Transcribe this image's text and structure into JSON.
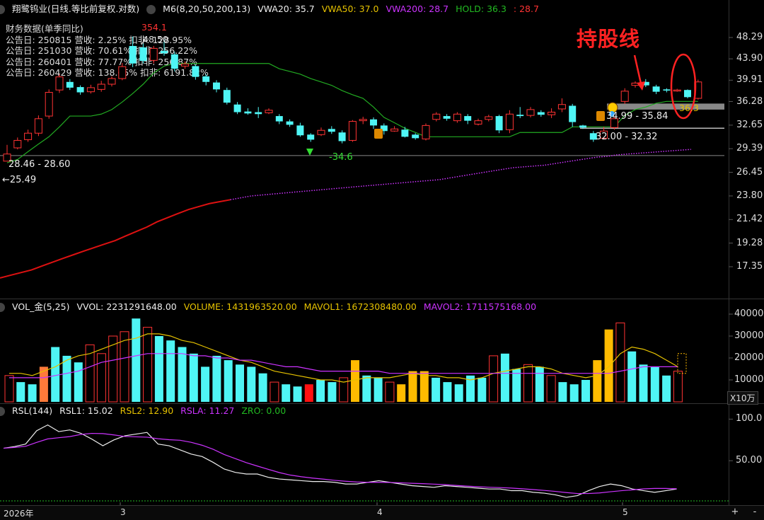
{
  "header": {
    "title": "翔鹭钨业(日线.等比前复权.对数)",
    "m6": "M6(8,20,50,200,13)",
    "vwa20": "VWA20: 35.7",
    "vwa50": "VWA50: 37.0",
    "vwa200": "VWA200: 28.7",
    "hold": "HOLD: 36.3",
    "hold_val2": ": 28.7"
  },
  "finance": {
    "title": "财务数据(单季同比)",
    "rows": [
      "公告日: 250815  营收: 2.25%  扣非: 128.95%",
      "公告日: 251030  营收: 70.61%  扣非: 256.22%",
      "公告日: 260401  营收: 77.77%  扣非: 256.87%",
      "公告日: 260429  营收: 138.65%  扣非: 6191.82%"
    ]
  },
  "annotations": {
    "peak": "354.1",
    "peak2": "48.50",
    "low_label": "28.46 - 28.60",
    "arrow_label": "←25.49",
    "diamond_label": "-34.6",
    "band1": "34.99 - 35.84",
    "band2": "32.00 - 32.32",
    "hold_tag": "36.3",
    "callout": "持股线"
  },
  "price_axis": [
    "48.29",
    "43.90",
    "39.91",
    "36.28",
    "32.65",
    "29.39",
    "26.45",
    "23.80",
    "21.42",
    "19.28",
    "17.35"
  ],
  "volume_header": {
    "name": "VOL_金(5,25)",
    "vvol": "VVOL: 2231291648.00",
    "volume": "VOLUME: 1431963520.00",
    "mavol1": "MAVOL1: 1672308480.00",
    "mavol2": "MAVOL2: 1711575168.00"
  },
  "volume_axis": [
    "40000",
    "30000",
    "20000",
    "10000"
  ],
  "volume_unit": "X10万",
  "rsl_header": {
    "name": "RSL(144)",
    "rsl1": "RSL1: 15.02",
    "rsl2": "RSL2: 12.90",
    "rsla": "RSLA: 11.27",
    "zro": "ZRO: 0.00"
  },
  "rsl_axis": [
    "100.0",
    "50.00"
  ],
  "time_axis": [
    "2026年",
    "3",
    "4",
    "5"
  ],
  "zoom": {
    "plus": "+",
    "minus": "-"
  },
  "colors": {
    "up": "#ff3333",
    "down": "#4ff5f5",
    "gold": "#ffbb00",
    "orange": "#ff7a3a",
    "green": "#22aa22",
    "purple": "#cc33ff",
    "yellow": "#e6c200"
  },
  "chart_data": {
    "type": "candlestick",
    "candles": [
      [
        27.8,
        28.7,
        28.2,
        29.9,
        "u"
      ],
      [
        29.5,
        30.5,
        29.3,
        30.9,
        "u"
      ],
      [
        30.6,
        31.5,
        30.3,
        32.0,
        "u"
      ],
      [
        31.5,
        33.6,
        31.1,
        34.1,
        "u"
      ],
      [
        34.0,
        37.8,
        33.6,
        38.3,
        "u"
      ],
      [
        38.2,
        40.5,
        37.7,
        41.0,
        "u"
      ],
      [
        39.6,
        38.6,
        38.2,
        40.1,
        "d"
      ],
      [
        38.7,
        37.8,
        37.4,
        39.0,
        "d"
      ],
      [
        37.9,
        38.6,
        37.6,
        39.1,
        "u"
      ],
      [
        38.3,
        39.2,
        37.9,
        39.8,
        "u"
      ],
      [
        39.2,
        40.2,
        38.8,
        40.6,
        "u"
      ],
      [
        40.2,
        42.4,
        39.9,
        43.1,
        "u"
      ],
      [
        43.0,
        46.5,
        42.3,
        48.5,
        "d"
      ],
      [
        46.2,
        43.5,
        43.0,
        47.0,
        "d"
      ],
      [
        43.6,
        46.0,
        43.0,
        46.5,
        "u"
      ],
      [
        45.5,
        45.0,
        44.5,
        47.9,
        "d"
      ],
      [
        44.8,
        42.0,
        41.5,
        45.3,
        "d"
      ],
      [
        42.5,
        42.9,
        42.0,
        43.4,
        "u"
      ],
      [
        42.5,
        40.5,
        40.0,
        42.8,
        "d"
      ],
      [
        40.6,
        39.6,
        39.0,
        41.0,
        "d"
      ],
      [
        39.5,
        38.3,
        37.8,
        39.9,
        "d"
      ],
      [
        38.2,
        36.1,
        35.8,
        38.6,
        "d"
      ],
      [
        35.8,
        34.6,
        34.3,
        36.2,
        "d"
      ],
      [
        34.7,
        34.4,
        34.2,
        35.2,
        "d"
      ],
      [
        34.3,
        34.6,
        33.7,
        35.4,
        "d"
      ],
      [
        34.5,
        34.9,
        34.3,
        35.2,
        "u"
      ],
      [
        34.0,
        33.2,
        32.8,
        34.3,
        "d"
      ],
      [
        33.2,
        32.7,
        32.4,
        33.5,
        "d"
      ],
      [
        32.6,
        31.2,
        31.0,
        33.0,
        "d"
      ],
      [
        31.3,
        30.6,
        30.3,
        31.5,
        "d"
      ],
      [
        31.3,
        31.9,
        31.1,
        32.3,
        "u"
      ],
      [
        32.1,
        31.7,
        31.4,
        32.5,
        "d"
      ],
      [
        31.6,
        30.4,
        30.1,
        31.9,
        "d"
      ],
      [
        30.5,
        33.2,
        30.3,
        33.4,
        "u"
      ],
      [
        33.3,
        33.5,
        32.8,
        33.9,
        "u"
      ],
      [
        33.5,
        32.6,
        32.1,
        33.8,
        "d"
      ],
      [
        32.6,
        31.8,
        31.3,
        32.9,
        "d"
      ],
      [
        31.8,
        32.1,
        31.7,
        32.5,
        "u"
      ],
      [
        32.0,
        31.0,
        30.9,
        32.4,
        "d"
      ],
      [
        30.8,
        31.3,
        30.6,
        31.5,
        "d"
      ],
      [
        30.7,
        32.6,
        30.5,
        32.9,
        "u"
      ],
      [
        33.5,
        34.3,
        33.2,
        34.6,
        "u"
      ],
      [
        34.0,
        33.6,
        33.3,
        34.3,
        "d"
      ],
      [
        33.3,
        34.3,
        33.0,
        34.6,
        "u"
      ],
      [
        34.0,
        33.3,
        32.8,
        34.3,
        "d"
      ],
      [
        33.3,
        32.8,
        32.6,
        33.6,
        "u"
      ],
      [
        33.5,
        33.9,
        33.2,
        34.2,
        "u"
      ],
      [
        34.0,
        31.9,
        31.5,
        34.2,
        "d"
      ],
      [
        32.0,
        34.3,
        31.5,
        34.9,
        "u"
      ],
      [
        34.2,
        34.0,
        33.7,
        35.4,
        "d"
      ],
      [
        34.1,
        35.0,
        33.8,
        35.4,
        "u"
      ],
      [
        34.6,
        34.2,
        33.9,
        34.9,
        "d"
      ],
      [
        34.2,
        34.6,
        33.7,
        35.2,
        "u"
      ],
      [
        35.1,
        35.8,
        34.6,
        36.8,
        "u"
      ],
      [
        35.6,
        33.1,
        32.4,
        35.9,
        "d"
      ],
      [
        32.6,
        32.3,
        32.1,
        32.7,
        "d"
      ],
      [
        31.5,
        30.6,
        30.3,
        31.8,
        "d"
      ],
      [
        30.8,
        31.8,
        30.6,
        32.4,
        "u"
      ],
      [
        32.3,
        33.6,
        32.0,
        33.9,
        "u"
      ],
      [
        36.3,
        38.0,
        35.9,
        38.5,
        "u"
      ],
      [
        39.0,
        39.4,
        38.6,
        39.7,
        "u"
      ],
      [
        39.6,
        39.0,
        38.7,
        40.1,
        "d"
      ],
      [
        38.8,
        37.9,
        37.5,
        39.1,
        "d"
      ],
      [
        38.3,
        38.1,
        37.8,
        38.5,
        "d"
      ],
      [
        38.1,
        38.2,
        37.9,
        38.4,
        "u"
      ],
      [
        38.2,
        37.0,
        36.8,
        38.3,
        "d"
      ],
      [
        36.8,
        39.6,
        36.6,
        40.0,
        "u"
      ]
    ],
    "hold_line": [
      27.6,
      28.0,
      29.0,
      30.0,
      31.0,
      32.4,
      34.0,
      34.0,
      34.0,
      34.3,
      35.0,
      36.2,
      37.6,
      39.2,
      41.2,
      42.5,
      43.0,
      43.0,
      43.0,
      43.0,
      43.0,
      43.0,
      43.0,
      43.0,
      43.0,
      43.0,
      42.0,
      41.5,
      41.0,
      40.2,
      39.6,
      39.0,
      38.1,
      37.4,
      36.8,
      35.4,
      33.8,
      33.0,
      32.2,
      31.6,
      31.0,
      31.0,
      31.0,
      31.0,
      31.0,
      31.0,
      31.0,
      31.0,
      31.0,
      31.6,
      31.6,
      31.6,
      31.6,
      31.6,
      32.4,
      32.4,
      32.4,
      32.4,
      32.4,
      34.1,
      35.0,
      35.4,
      36.0,
      36.3,
      36.3,
      36.3,
      36.3
    ],
    "ma200": [
      16.5,
      16.7,
      16.9,
      17.1,
      17.4,
      17.7,
      18.0,
      18.3,
      18.6,
      18.9,
      19.2,
      19.5,
      19.9,
      20.3,
      20.7,
      21.2,
      21.6,
      22.0,
      22.4,
      22.7,
      23.0,
      23.2,
      23.4,
      23.6,
      23.8,
      23.9,
      24.0,
      24.1,
      24.2,
      24.3,
      24.4,
      24.5,
      24.6,
      24.7,
      24.8,
      24.9,
      25.0,
      25.1,
      25.2,
      25.3,
      25.4,
      25.5,
      25.6,
      25.8,
      26.0,
      26.2,
      26.4,
      26.6,
      26.8,
      27.0,
      27.1,
      27.2,
      27.3,
      27.5,
      27.7,
      27.9,
      28.1,
      28.3,
      28.4,
      28.6,
      28.7,
      28.8,
      28.9,
      29.0,
      29.1,
      29.2,
      29.3
    ],
    "volume": [
      [
        12,
        "u"
      ],
      [
        9,
        "d"
      ],
      [
        8,
        "d"
      ],
      [
        16,
        "g"
      ],
      [
        25,
        "d"
      ],
      [
        21,
        "d"
      ],
      [
        18,
        "d"
      ],
      [
        26,
        "u"
      ],
      [
        22,
        "u"
      ],
      [
        30,
        "u"
      ],
      [
        32,
        "u"
      ],
      [
        38,
        "d"
      ],
      [
        34,
        "u"
      ],
      [
        30,
        "d"
      ],
      [
        28,
        "d"
      ],
      [
        25,
        "d"
      ],
      [
        22,
        "d"
      ],
      [
        16,
        "d"
      ],
      [
        21,
        "d"
      ],
      [
        19,
        "d"
      ],
      [
        17,
        "d"
      ],
      [
        16,
        "d"
      ],
      [
        13,
        "d"
      ],
      [
        9,
        "u"
      ],
      [
        8,
        "d"
      ],
      [
        7,
        "d"
      ],
      [
        8,
        "r"
      ],
      [
        10,
        "d"
      ],
      [
        9,
        "d"
      ],
      [
        11,
        "u"
      ],
      [
        19,
        "y"
      ],
      [
        12,
        "d"
      ],
      [
        11,
        "d"
      ],
      [
        9,
        "u"
      ],
      [
        8,
        "y"
      ],
      [
        14,
        "y"
      ],
      [
        14,
        "y"
      ],
      [
        11,
        "d"
      ],
      [
        9,
        "d"
      ],
      [
        8,
        "d"
      ],
      [
        12,
        "d"
      ],
      [
        11,
        "d"
      ],
      [
        21,
        "u"
      ],
      [
        22,
        "d"
      ],
      [
        15,
        "d"
      ],
      [
        17,
        "u"
      ],
      [
        16,
        "d"
      ],
      [
        12,
        "u"
      ],
      [
        9,
        "d"
      ],
      [
        8,
        "d"
      ],
      [
        10,
        "d"
      ],
      [
        19,
        "y"
      ],
      [
        33,
        "y"
      ],
      [
        36,
        "u"
      ],
      [
        23,
        "d"
      ],
      [
        17,
        "d"
      ],
      [
        16,
        "d"
      ],
      [
        12,
        "d"
      ],
      [
        14,
        "u"
      ]
    ],
    "mavol1": [
      13,
      13,
      12,
      14,
      16,
      19,
      21,
      22,
      24,
      26,
      28,
      29,
      31,
      31,
      30,
      28,
      27,
      25,
      23,
      21,
      19,
      18,
      16,
      14,
      13,
      12,
      11,
      10,
      10,
      9,
      10,
      11,
      11,
      11,
      12,
      13,
      12,
      12,
      11,
      11,
      10,
      11,
      13,
      14,
      15,
      16,
      16,
      15,
      13,
      12,
      11,
      12,
      16,
      22,
      25,
      24,
      22,
      19,
      16
    ],
    "mavol2": [
      11,
      11,
      11,
      11,
      12,
      13,
      14,
      16,
      18,
      19,
      20,
      21,
      22,
      22,
      22,
      22,
      21,
      21,
      20,
      20,
      19,
      19,
      18,
      17,
      16,
      16,
      15,
      14,
      14,
      14,
      14,
      14,
      14,
      13,
      13,
      13,
      13,
      13,
      13,
      13,
      13,
      13,
      13,
      13,
      13,
      13,
      13,
      13,
      13,
      13,
      13,
      13,
      13,
      14,
      15,
      16,
      16,
      16,
      16
    ],
    "rsl1": [
      65,
      67,
      70,
      86,
      93,
      85,
      87,
      83,
      76,
      68,
      75,
      80,
      82,
      84,
      70,
      68,
      63,
      58,
      55,
      48,
      40,
      36,
      34,
      34,
      30,
      28,
      27,
      26,
      25,
      25,
      24,
      22,
      22,
      24,
      26,
      24,
      22,
      20,
      19,
      18,
      20,
      19,
      18,
      17,
      16,
      16,
      14,
      14,
      12,
      11,
      9,
      6,
      8,
      14,
      19,
      22,
      20,
      16,
      14,
      12,
      14,
      16
    ]
  }
}
